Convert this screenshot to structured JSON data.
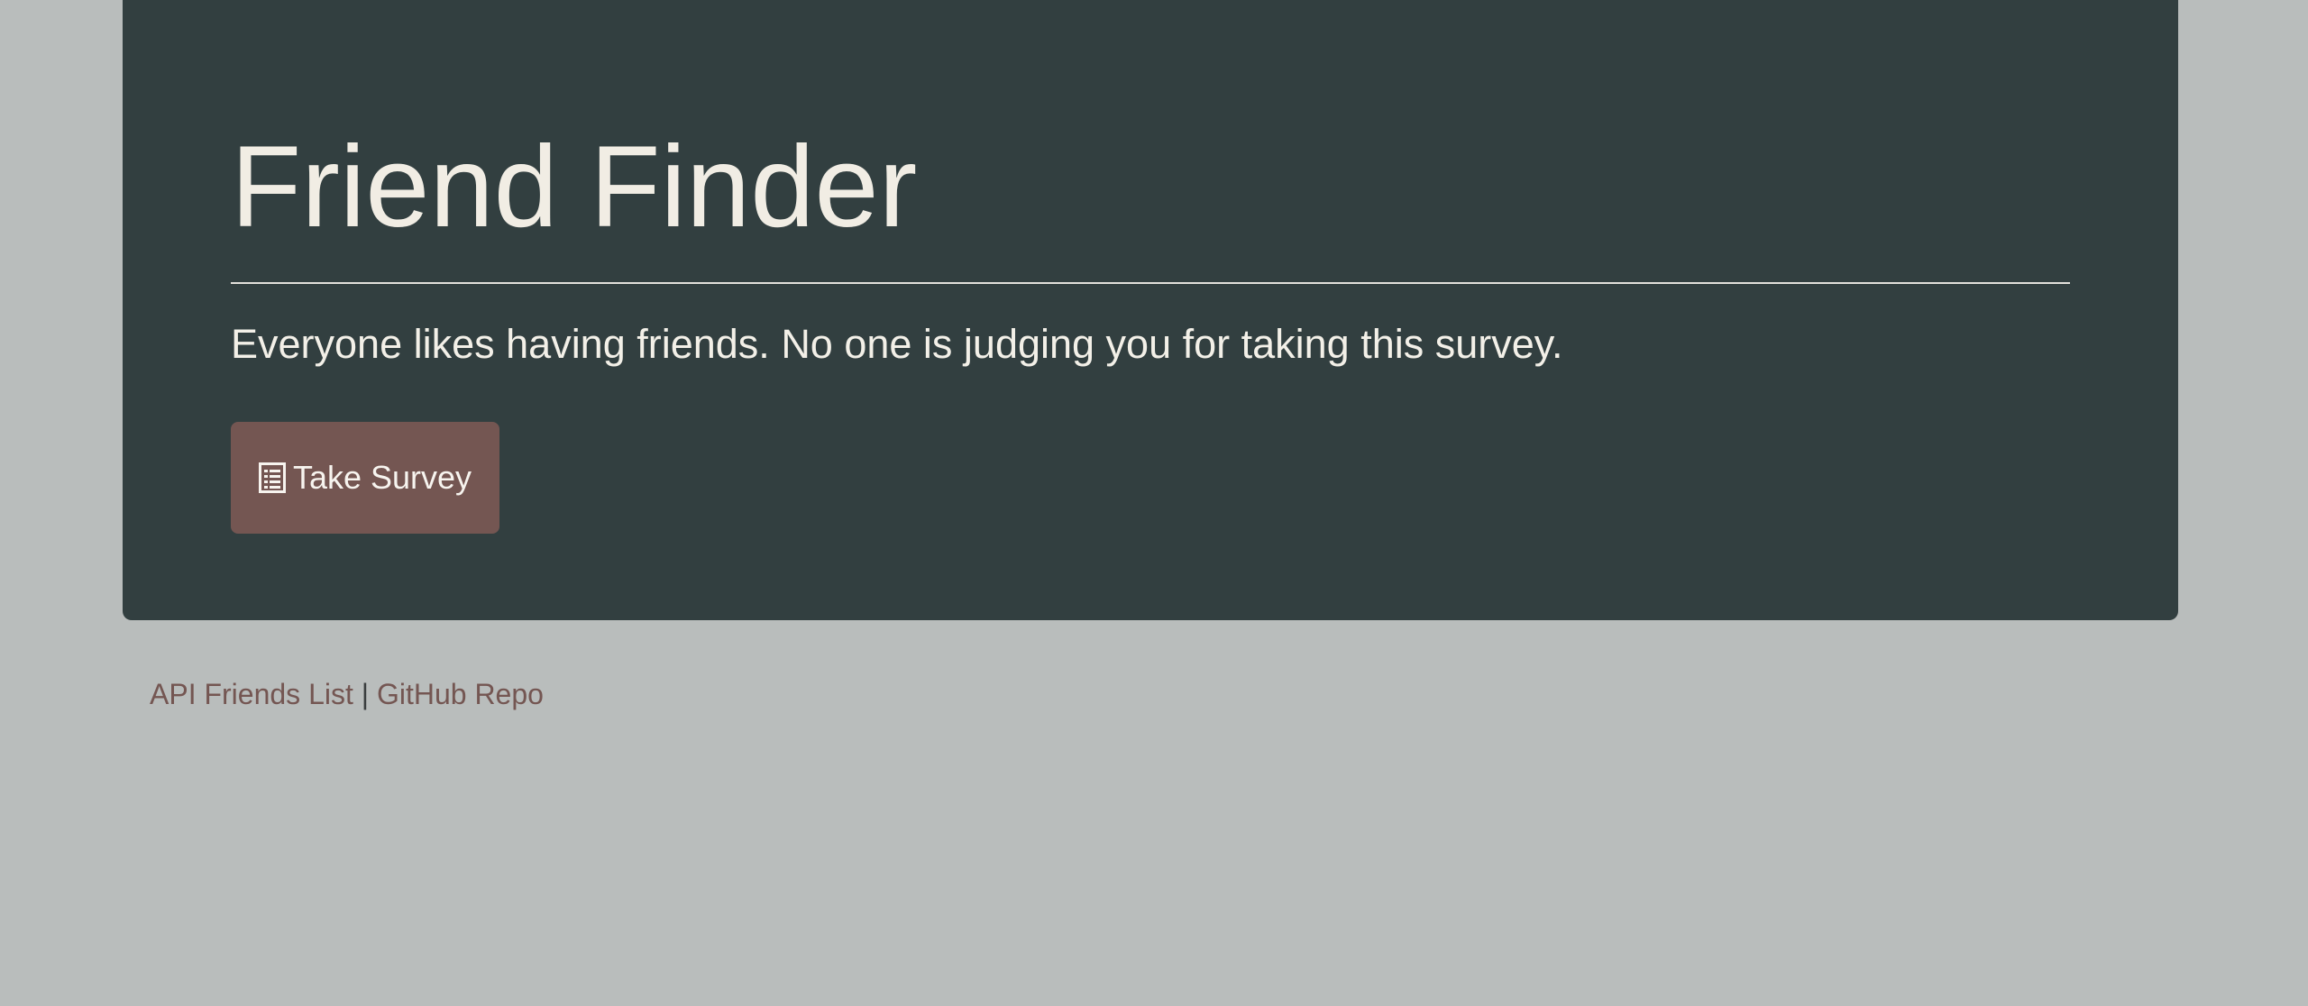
{
  "header": {
    "title": "Friend Finder",
    "lead": "Everyone likes having friends. No one is judging you for taking this survey."
  },
  "actions": {
    "take_survey_label": "Take Survey",
    "take_survey_icon": "list-alt-icon"
  },
  "footer": {
    "api_link_label": "API Friends List",
    "separator": "|",
    "github_link_label": "GitHub Repo"
  },
  "colors": {
    "background": "#b9bdbc",
    "panel": "#323f40",
    "accent": "#745652",
    "text_light": "#f1ede4"
  }
}
